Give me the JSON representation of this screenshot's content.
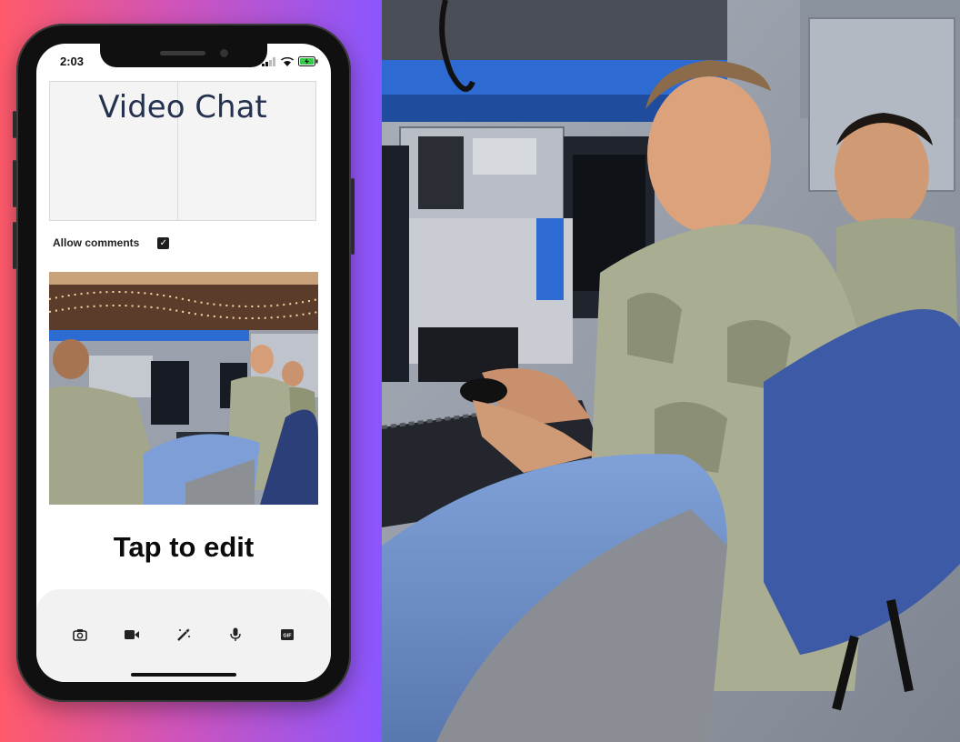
{
  "status_bar": {
    "time": "2:03"
  },
  "post": {
    "title": "Video Chat",
    "allow_comments_label": "Allow comments",
    "allow_comments_checked": true,
    "tap_to_edit": "Tap to edit"
  },
  "toolbar": {
    "items": [
      {
        "name": "camera-icon"
      },
      {
        "name": "video-icon"
      },
      {
        "name": "magic-wand-icon"
      },
      {
        "name": "microphone-icon"
      },
      {
        "name": "gif-icon",
        "label": "GIF"
      }
    ]
  },
  "colors": {
    "gradient_start": "#ff5a6a",
    "gradient_end": "#8a56ff",
    "title_text": "#24314f"
  }
}
